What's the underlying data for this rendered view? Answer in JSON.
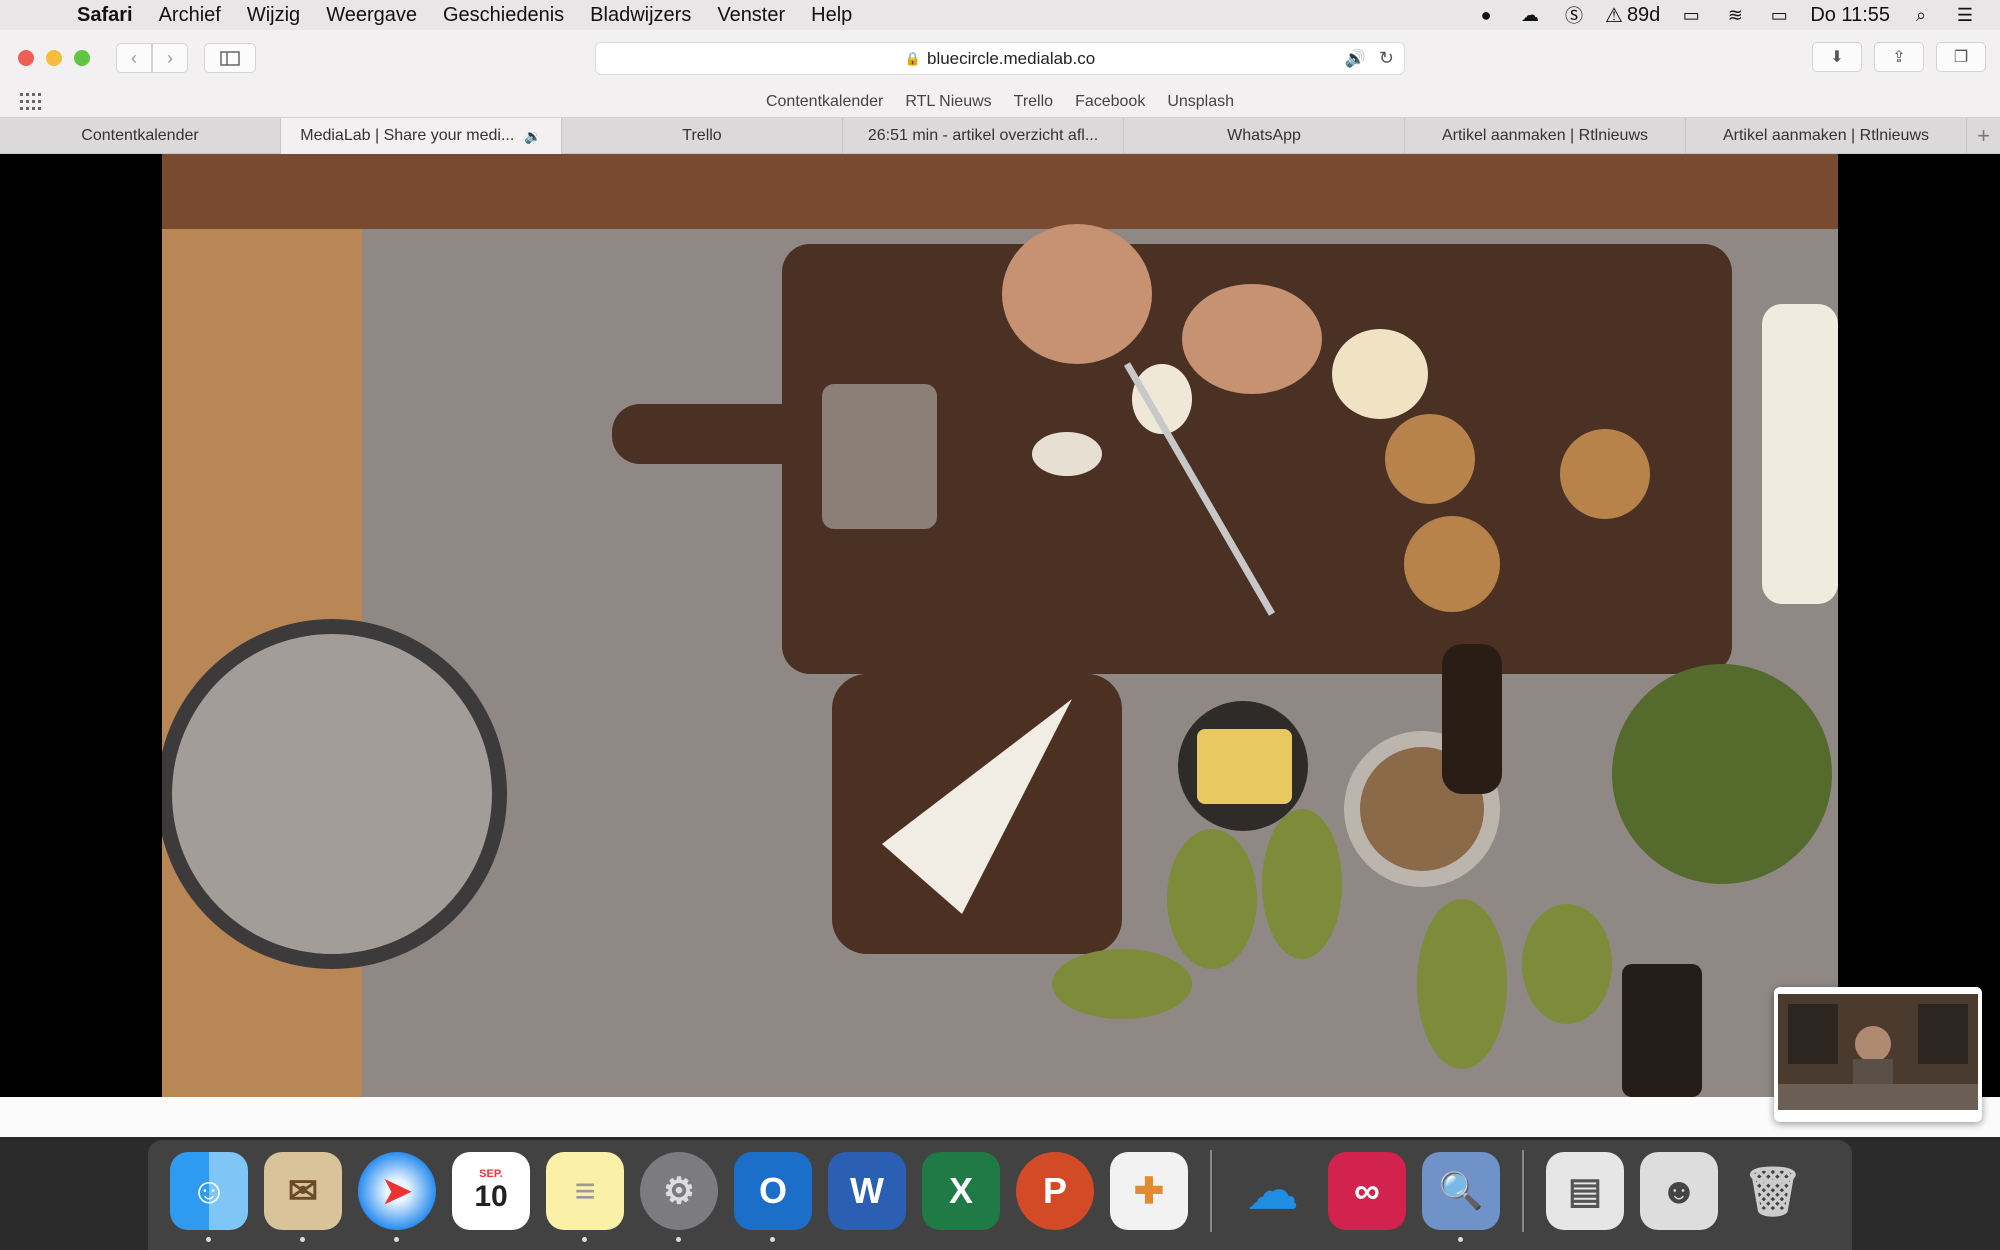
{
  "menubar": {
    "app": "Safari",
    "items": [
      "Archief",
      "Wijzig",
      "Weergave",
      "Geschiedenis",
      "Bladwijzers",
      "Venster",
      "Help"
    ],
    "battery_label": "89d",
    "clock": "Do 11:55"
  },
  "toolbar": {
    "url": "bluecircle.medialab.co"
  },
  "bookmarks": [
    "Contentkalender",
    "RTL Nieuws",
    "Trello",
    "Facebook",
    "Unsplash"
  ],
  "tabs": [
    {
      "label": "Contentkalender"
    },
    {
      "label": "MediaLab | Share your medi..."
    },
    {
      "label": "Trello"
    },
    {
      "label": "26:51 min - artikel overzicht afl..."
    },
    {
      "label": "WhatsApp"
    },
    {
      "label": "Artikel aanmaken | Rtlnieuws"
    },
    {
      "label": "Artikel aanmaken | Rtlnieuws"
    }
  ],
  "dock": {
    "calendar_month": "SEP.",
    "calendar_day": "10",
    "icons": [
      "finder-icon",
      "mail-icon",
      "safari-icon",
      "calendar-icon",
      "notes-icon",
      "system-preferences-icon",
      "outlook-icon",
      "word-icon",
      "excel-icon",
      "powerpoint-icon",
      "photos-app-icon",
      "onedrive-icon",
      "creative-cloud-icon",
      "preview-icon",
      "downloads-stack-icon",
      "documents-stack-icon",
      "trash-icon"
    ]
  },
  "colors": {
    "close": "#ee5f57",
    "minimize": "#f5bd3a",
    "maximize": "#5fc543",
    "accent": "#2b74e0"
  }
}
